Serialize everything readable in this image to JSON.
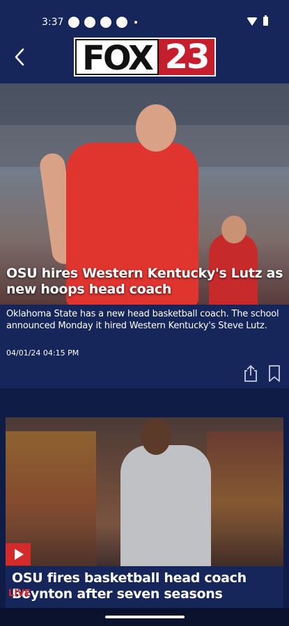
{
  "status_bar": {
    "time": "3:37"
  },
  "header": {
    "logo_text_left": "FOX",
    "logo_text_right": "23",
    "colors": {
      "background": "#16255a",
      "logo_red": "#c51f2e"
    }
  },
  "articles": [
    {
      "headline": "OSU hires Western Kentucky's Lutz as new hoops head coach",
      "summary": "Oklahoma State has a new head basketball coach. The school announced Monday it hired Western Kentucky's Steve Lutz.",
      "date": "04/01/24 04:15 PM",
      "actions": [
        "share-icon",
        "bookmark-icon"
      ]
    },
    {
      "headline": "OSU fires basketball head coach Boynton after seven seasons",
      "badge": "LIVE",
      "media_icon": "play-icon"
    }
  ]
}
